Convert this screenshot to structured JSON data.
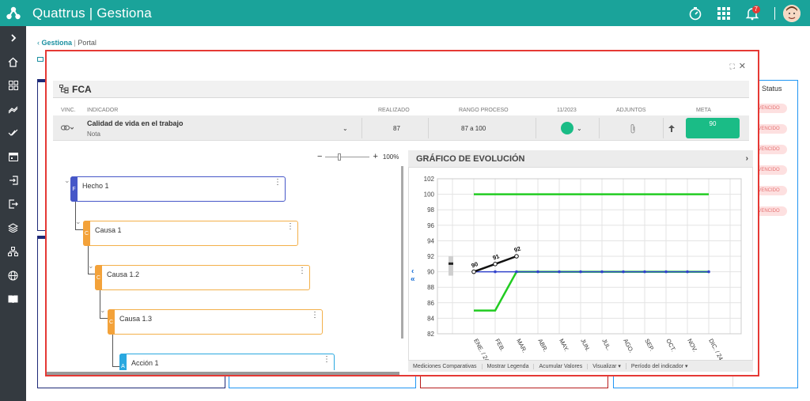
{
  "app": {
    "brand": "Quattrus | Gestiona",
    "notifications": "7"
  },
  "breadcrumb": {
    "link": "Gestiona",
    "current": "Portal"
  },
  "status_column": {
    "header": "Status",
    "badges": [
      "VENCIDO",
      "VENCIDO",
      "VENCIDO",
      "VENCIDO",
      "VENCIDO",
      "VENCIDO"
    ]
  },
  "panel": {
    "title": "FCA",
    "columns": {
      "vinc": "VINC.",
      "indicador": "INDICADOR",
      "realizado": "REALIZADO",
      "rango": "RANGO PROCESO",
      "period": "11/2023",
      "adjuntos": "ADJUNTOS",
      "meta": "META"
    },
    "row": {
      "indicator": "Calidad de vida en el trabajo",
      "sub": "Nota",
      "realizado": "87",
      "rango": "87 a 100",
      "status_color": "#1abc86",
      "meta": "90"
    }
  },
  "tree": {
    "zoom": "100%",
    "nodes": [
      {
        "tag": "F",
        "label": "Hecho 1"
      },
      {
        "tag": "C",
        "label": "Causa 1"
      },
      {
        "tag": "C",
        "label": "Causa 1.2"
      },
      {
        "tag": "C",
        "label": "Causa 1.3"
      },
      {
        "tag": "A",
        "label": "Acción 1"
      }
    ]
  },
  "chart": {
    "title": "GRÁFICO DE EVOLUCIÓN",
    "footer": [
      "Mediciones Comparativas",
      "Mostrar Legenda",
      "Acumular Valores",
      "Visualizar ▾",
      "Período del indicador ▾"
    ]
  },
  "chart_data": {
    "type": "line",
    "categories": [
      "ENE. / 24",
      "FEB.",
      "MAR.",
      "ABR.",
      "MAY.",
      "JUN.",
      "JUL.",
      "AGO.",
      "SEP.",
      "OCT.",
      "NOV.",
      "DIC. / 24"
    ],
    "ylim": [
      82,
      102
    ],
    "yticks": [
      82,
      84,
      86,
      88,
      90,
      92,
      94,
      96,
      98,
      100,
      102
    ],
    "grid": true,
    "series": [
      {
        "color": "#22cc22",
        "values": [
          100,
          100,
          100,
          100,
          100,
          100,
          100,
          100,
          100,
          100,
          100,
          100
        ]
      },
      {
        "color": "#22cc22",
        "values": [
          85,
          85,
          90,
          90,
          90,
          90,
          90,
          90,
          90,
          90,
          90,
          90
        ]
      },
      {
        "color": "#3344cc",
        "values": [
          90,
          90,
          90,
          90,
          90,
          90,
          90,
          90,
          90,
          90,
          90,
          90
        ]
      },
      {
        "color": "#111111",
        "values": [
          90,
          91,
          92
        ],
        "labels": [
          "90",
          "91",
          "92"
        ]
      }
    ]
  }
}
